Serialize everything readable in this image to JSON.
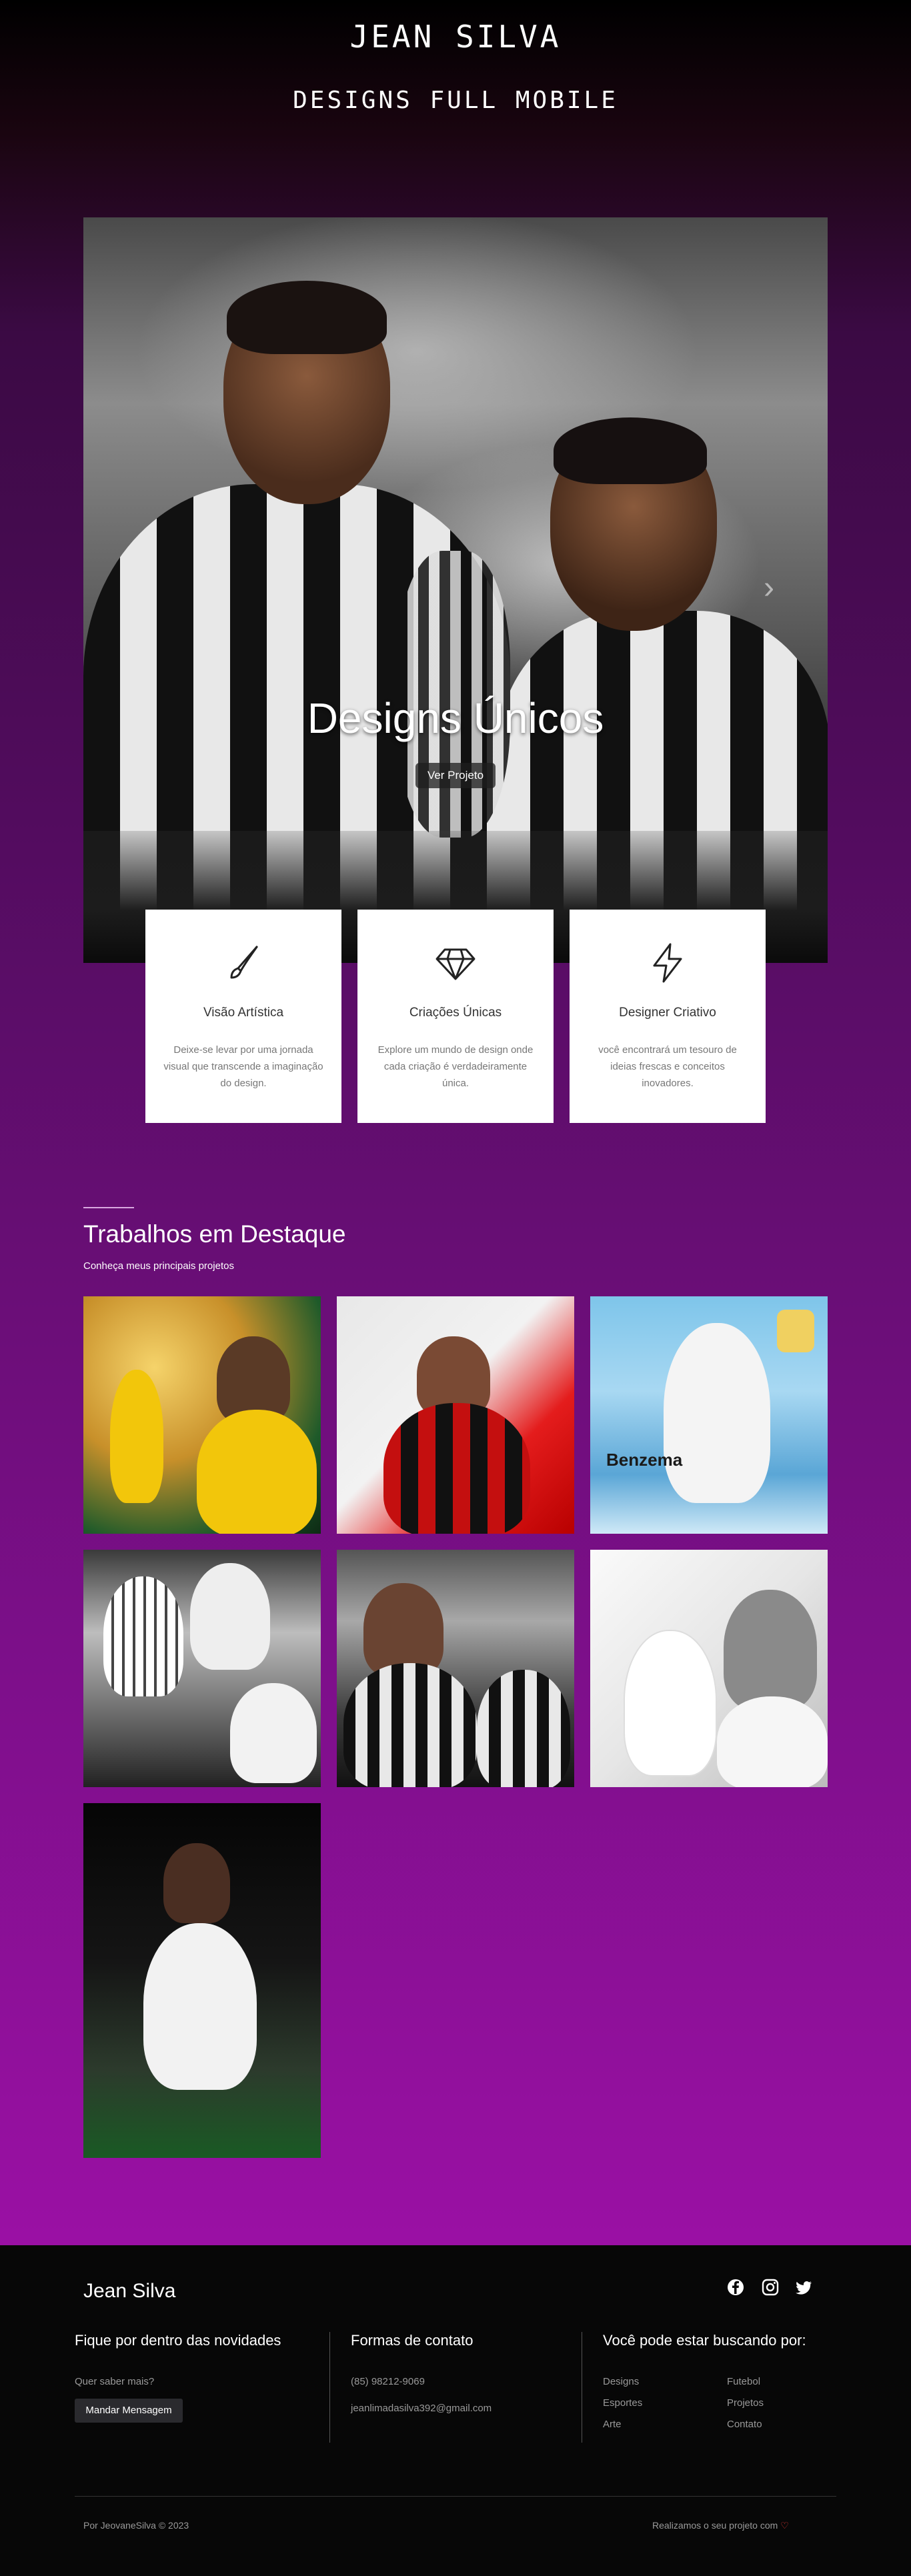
{
  "header": {
    "name": "JEAN SILVA",
    "subtitle": "DESIGNS FULL MOBILE"
  },
  "hero": {
    "caption": "Designs Únicos",
    "button": "Ver Projeto"
  },
  "features": [
    {
      "icon": "brush-icon",
      "title": "Visão Artística",
      "desc": "Deixe-se levar por uma jornada visual que transcende a imaginação do design."
    },
    {
      "icon": "diamond-icon",
      "title": "Criações Únicas",
      "desc": "Explore um mundo de design onde cada criação é verdadeiramente única."
    },
    {
      "icon": "lightning-icon",
      "title": "Designer Criativo",
      "desc": "você encontrará um tesouro de ideias frescas e conceitos inovadores."
    }
  ],
  "portfolio": {
    "title": "Trabalhos em Destaque",
    "subtitle": "Conheça meus principais projetos",
    "tile_text": {
      "benzema": "Benzema"
    }
  },
  "footer": {
    "brand": "Jean Silva",
    "col1": {
      "title": "Fique por dentro das novidades",
      "prompt": "Quer saber mais?",
      "button": "Mandar Mensagem"
    },
    "col2": {
      "title": "Formas de contato",
      "phone": "(85) 98212-9069",
      "email": "jeanlimadasilva392@gmail.com"
    },
    "col3": {
      "title": "Você pode estar buscando por:",
      "links": [
        "Designs",
        "Futebol",
        "Esportes",
        "Projetos",
        "Arte",
        "Contato"
      ]
    },
    "copyright": "Por JeovaneSilva © 2023",
    "made": "Realizamos o seu projeto com",
    "made_heart": "♡",
    "colors": {
      "heart": "#e53935",
      "bg": "#070707"
    }
  }
}
